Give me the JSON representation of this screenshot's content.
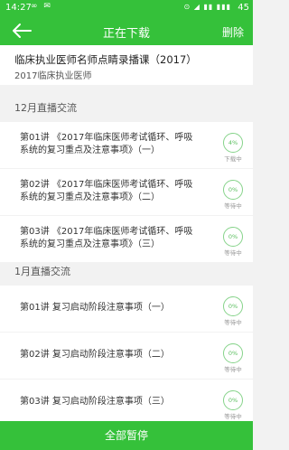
{
  "status_bar": {
    "time": "14:27",
    "left_icons": "∞ ✉",
    "right_icons": "⊙ ◢ ▮▮ ▮▮▮",
    "battery": "45"
  },
  "app_bar": {
    "title": "正在下载",
    "delete_label": "删除"
  },
  "course": {
    "name": "临床执业医师名师点睛录播课（2017）",
    "subtitle": "2017临床执业医师"
  },
  "sections": [
    {
      "title": "12月直播交流",
      "items": [
        {
          "line1": "第01讲 《2017年临床医师考试循环、呼吸",
          "line2": "系统的复习重点及注意事项》（一）",
          "percent": "4%",
          "status": "下载中"
        },
        {
          "line1": "第02讲 《2017年临床医师考试循环、呼吸",
          "line2": "系统的复习重点及注意事项》（二）",
          "percent": "0%",
          "status": "等待中"
        },
        {
          "line1": "第03讲 《2017年临床医师考试循环、呼吸",
          "line2": "系统的复习重点及注意事项》（三）",
          "percent": "0%",
          "status": "等待中"
        }
      ]
    },
    {
      "title": "1月直播交流",
      "items": [
        {
          "line1": "第01讲 复习启动阶段注意事项（一）",
          "percent": "0%",
          "status": "等待中"
        },
        {
          "line1": "第02讲 复习启动阶段注意事项（二）",
          "percent": "0%",
          "status": "等待中"
        },
        {
          "line1": "第03讲 复习启动阶段注意事项（三）",
          "percent": "0%",
          "status": "等待中"
        }
      ]
    }
  ],
  "bottom_button": "全部暂停",
  "colors": {
    "brand_green": "#35c13a",
    "progress_ring": "#86d38a",
    "background": "#f2f2f2"
  }
}
